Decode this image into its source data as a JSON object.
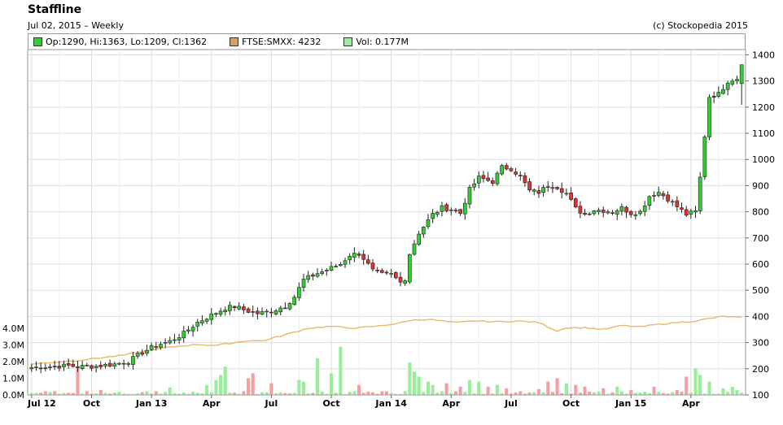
{
  "header": {
    "title": "Staffline",
    "subtitle": "Jul 02, 2015 – Weekly",
    "copyright": "(c) Stockopedia 2015"
  },
  "legend": [
    {
      "label": "Op:1290, Hi:1363, Lo:1209, Cl:1362",
      "color": "#33cc33"
    },
    {
      "label": "FTSE:SMXX: 4232",
      "color": "#d9a060"
    },
    {
      "label": "Vol: 0.177M",
      "color": "#99ee99"
    }
  ],
  "colors": {
    "up": "#33cc33",
    "down": "#dd3333",
    "index": "#e8b86d",
    "vol_up": "#99ee99",
    "vol_down": "#f4a0a0",
    "grid": "#dddddd"
  },
  "chart_data": {
    "type": "candlestick",
    "ylim": [
      100,
      1420
    ],
    "y_ticks": [
      100,
      200,
      300,
      400,
      500,
      600,
      700,
      800,
      900,
      1000,
      1100,
      1200,
      1300,
      1400
    ],
    "vol_ticks": [
      "0.0M",
      "1.0M",
      "2.0M",
      "3.0M",
      "4.0M"
    ],
    "vol_max": 4.0,
    "x_labels": [
      "Jul 12",
      "Oct",
      "Jan 13",
      "Apr",
      "Jul",
      "Oct",
      "Jan 14",
      "Apr",
      "Jul",
      "Oct",
      "Jan 15",
      "Apr"
    ],
    "x_label_weeks": [
      0,
      13,
      26,
      39,
      52,
      65,
      78,
      91,
      104,
      117,
      130,
      143
    ],
    "close_anchors": [
      [
        0,
        205
      ],
      [
        4,
        208
      ],
      [
        8,
        212
      ],
      [
        10,
        208
      ],
      [
        14,
        210
      ],
      [
        18,
        218
      ],
      [
        21,
        228
      ],
      [
        24,
        262
      ],
      [
        27,
        290
      ],
      [
        30,
        305
      ],
      [
        33,
        335
      ],
      [
        36,
        378
      ],
      [
        39,
        405
      ],
      [
        42,
        432
      ],
      [
        44,
        438
      ],
      [
        47,
        420
      ],
      [
        49,
        412
      ],
      [
        52,
        420
      ],
      [
        55,
        440
      ],
      [
        57,
        475
      ],
      [
        59,
        540
      ],
      [
        62,
        565
      ],
      [
        64,
        578
      ],
      [
        67,
        600
      ],
      [
        69,
        635
      ],
      [
        71,
        640
      ],
      [
        72,
        622
      ],
      [
        74,
        575
      ],
      [
        76,
        560
      ],
      [
        78,
        560
      ],
      [
        80,
        530
      ],
      [
        81,
        545
      ],
      [
        82,
        640
      ],
      [
        84,
        720
      ],
      [
        87,
        790
      ],
      [
        89,
        815
      ],
      [
        91,
        810
      ],
      [
        93,
        795
      ],
      [
        95,
        885
      ],
      [
        97,
        930
      ],
      [
        100,
        915
      ],
      [
        102,
        970
      ],
      [
        104,
        965
      ],
      [
        106,
        935
      ],
      [
        108,
        880
      ],
      [
        110,
        875
      ],
      [
        112,
        900
      ],
      [
        114,
        895
      ],
      [
        116,
        870
      ],
      [
        118,
        812
      ],
      [
        120,
        790
      ],
      [
        122,
        808
      ],
      [
        124,
        805
      ],
      [
        126,
        800
      ],
      [
        128,
        815
      ],
      [
        130,
        795
      ],
      [
        132,
        800
      ],
      [
        134,
        860
      ],
      [
        136,
        875
      ],
      [
        138,
        850
      ],
      [
        140,
        820
      ],
      [
        142,
        790
      ],
      [
        144,
        800
      ],
      [
        145,
        930
      ],
      [
        146,
        1090
      ],
      [
        147,
        1240
      ],
      [
        149,
        1250
      ],
      [
        151,
        1300
      ],
      [
        153,
        1310
      ],
      [
        154,
        1362
      ]
    ],
    "index_anchors": [
      [
        0,
        218
      ],
      [
        10,
        232
      ],
      [
        20,
        252
      ],
      [
        28,
        278
      ],
      [
        33,
        288
      ],
      [
        36,
        293
      ],
      [
        40,
        289
      ],
      [
        44,
        300
      ],
      [
        47,
        308
      ],
      [
        50,
        306
      ],
      [
        55,
        330
      ],
      [
        60,
        355
      ],
      [
        65,
        362
      ],
      [
        70,
        355
      ],
      [
        75,
        363
      ],
      [
        80,
        375
      ],
      [
        82,
        385
      ],
      [
        86,
        389
      ],
      [
        92,
        376
      ],
      [
        96,
        383
      ],
      [
        100,
        380
      ],
      [
        106,
        382
      ],
      [
        110,
        377
      ],
      [
        112,
        360
      ],
      [
        114,
        345
      ],
      [
        116,
        357
      ],
      [
        120,
        357
      ],
      [
        124,
        350
      ],
      [
        128,
        365
      ],
      [
        132,
        360
      ],
      [
        136,
        370
      ],
      [
        140,
        377
      ],
      [
        144,
        383
      ],
      [
        148,
        395
      ],
      [
        150,
        400
      ],
      [
        154,
        396
      ]
    ],
    "volume_spikes": [
      [
        10,
        1.65
      ],
      [
        15,
        0.3
      ],
      [
        30,
        0.45
      ],
      [
        38,
        0.6
      ],
      [
        40,
        0.9
      ],
      [
        41,
        1.2
      ],
      [
        42,
        1.7
      ],
      [
        47,
        1.0
      ],
      [
        48,
        1.3
      ],
      [
        52,
        0.7
      ],
      [
        58,
        0.9
      ],
      [
        59,
        0.8
      ],
      [
        62,
        2.2
      ],
      [
        65,
        1.3
      ],
      [
        67,
        2.9
      ],
      [
        71,
        0.6
      ],
      [
        82,
        1.95
      ],
      [
        83,
        1.4
      ],
      [
        84,
        1.1
      ],
      [
        86,
        0.8
      ],
      [
        87,
        0.6
      ],
      [
        90,
        0.7
      ],
      [
        93,
        0.5
      ],
      [
        95,
        0.9
      ],
      [
        97,
        0.8
      ],
      [
        99,
        0.5
      ],
      [
        101,
        0.6
      ],
      [
        103,
        0.4
      ],
      [
        110,
        0.35
      ],
      [
        112,
        0.8
      ],
      [
        114,
        1.0
      ],
      [
        116,
        0.7
      ],
      [
        118,
        0.6
      ],
      [
        120,
        0.5
      ],
      [
        124,
        0.4
      ],
      [
        127,
        0.5
      ],
      [
        130,
        0.3
      ],
      [
        135,
        0.5
      ],
      [
        140,
        0.3
      ],
      [
        142,
        1.1
      ],
      [
        144,
        1.6
      ],
      [
        145,
        1.2
      ],
      [
        147,
        0.8
      ],
      [
        150,
        0.4
      ],
      [
        152,
        0.5
      ],
      [
        153,
        0.3
      ]
    ],
    "weeks": 155
  }
}
